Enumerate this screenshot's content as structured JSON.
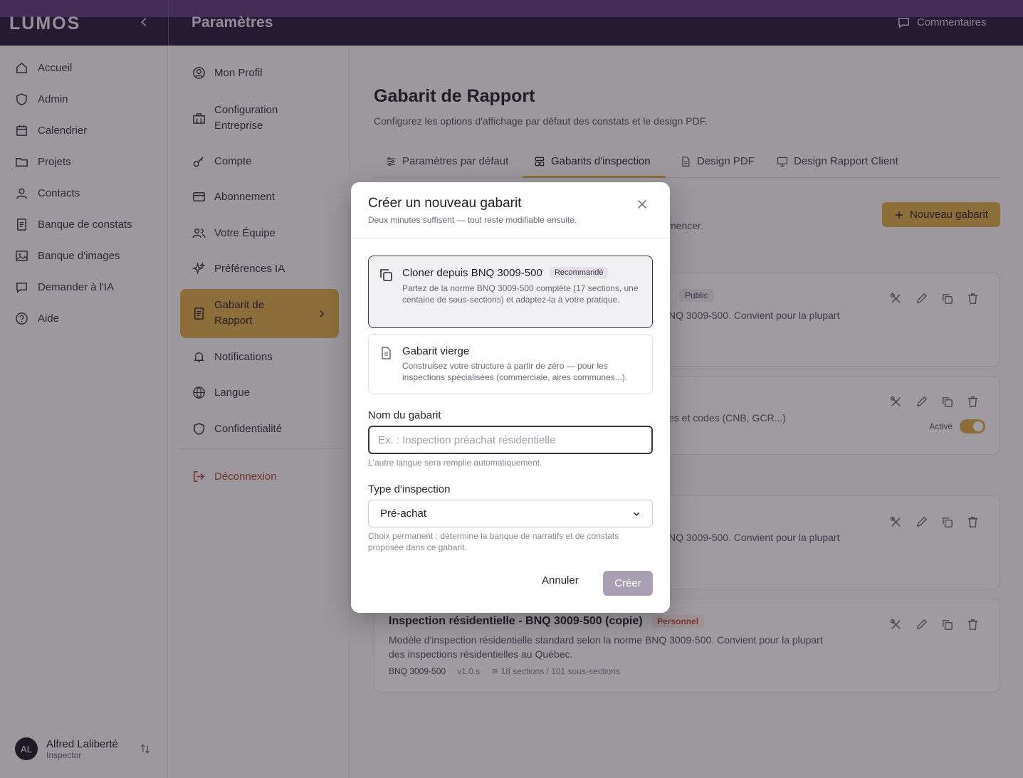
{
  "app": {
    "logo": "LUMOS",
    "page_title": "Paramètres",
    "feedback_label": "Commentaires"
  },
  "sidebar": {
    "items": [
      {
        "label": "Accueil",
        "icon": "home-icon"
      },
      {
        "label": "Admin",
        "icon": "shield-icon"
      },
      {
        "label": "Calendrier",
        "icon": "calendar-icon"
      },
      {
        "label": "Projets",
        "icon": "folder-icon"
      },
      {
        "label": "Contacts",
        "icon": "user-icon"
      },
      {
        "label": "Banque de constats",
        "icon": "document-icon"
      },
      {
        "label": "Banque d'images",
        "icon": "image-icon"
      },
      {
        "label": "Demander à l'IA",
        "icon": "chat-icon"
      },
      {
        "label": "Aide",
        "icon": "help-icon"
      }
    ],
    "user": {
      "initials": "AL",
      "name": "Alfred Laliberté",
      "role": "Inspector"
    }
  },
  "settings_menu": {
    "items": [
      {
        "label": "Mon Profil"
      },
      {
        "label": "Configuration Entreprise"
      },
      {
        "label": "Compte"
      },
      {
        "label": "Abonnement"
      },
      {
        "label": "Votre Équipe"
      },
      {
        "label": "Préférences IA"
      },
      {
        "label": "Gabarit de Rapport",
        "active": true
      },
      {
        "label": "Notifications"
      },
      {
        "label": "Langue"
      },
      {
        "label": "Confidentialité"
      }
    ],
    "logout": "Déconnexion"
  },
  "main": {
    "title": "Gabarit de Rapport",
    "subtitle": "Configurez les options d'affichage par défaut des constats et le design PDF.",
    "tabs": [
      {
        "label": "Paramètres par défaut"
      },
      {
        "label": "Gabarits d'inspection",
        "active": true
      },
      {
        "label": "Design PDF"
      },
      {
        "label": "Design Rapport Client"
      }
    ],
    "new_button": "Nouveau gabarit",
    "hint_fragment": "mencer.",
    "cards": [
      {
        "badge": "Public",
        "desc_fragment": "NQ 3009-500. Convient pour la plupart"
      },
      {
        "desc_fragment": "es et codes (CNB, GCR...)",
        "active_label": "Activé"
      },
      {
        "desc_fragment": "NQ 3009-500. Convient pour la plupart"
      },
      {
        "title": "Inspection résidentielle - BNQ 3009-500 (copie)",
        "badge": "Personnel",
        "desc_line1": "Modèle d'inspection résidentielle standard selon la norme BNQ 3009-500. Convient pour la plupart",
        "desc_line2": "des inspections résidentielles au Québec.",
        "meta_norm": "BNQ 3009-500",
        "meta_version": "v1.0.s",
        "meta_sections": "18 sections / 101 sous-sections"
      }
    ]
  },
  "modal": {
    "title": "Créer un nouveau gabarit",
    "subtitle": "Deux minutes suffisent — tout reste modifiable ensuite.",
    "option_clone": {
      "title": "Cloner depuis BNQ 3009-500",
      "badge": "Recommandé",
      "desc": "Partez de la norme BNQ 3009-500 complète (17 sections, une centaine de sous-sections) et adaptez-la à votre pratique."
    },
    "option_blank": {
      "title": "Gabarit vierge",
      "desc": "Construisez votre structure à partir de zéro — pour les inspections spécialisées (commerciale, aires communes...)."
    },
    "name_label": "Nom du gabarit",
    "name_placeholder": "Ex. : Inspection préachat résidentielle",
    "name_value": "",
    "name_hint": "L'autre langue sera remplie automatiquement.",
    "type_label": "Type d'inspection",
    "type_value": "Pré-achat",
    "type_hint": "Choix permanent : détermine la banque de narratifs et de constats proposée dans ce gabarit.",
    "cancel": "Annuler",
    "create": "Créer"
  },
  "colors": {
    "accent": "#d9ad4a",
    "topbar": "#2b1a3d",
    "personal_badge": "#c0533a"
  }
}
